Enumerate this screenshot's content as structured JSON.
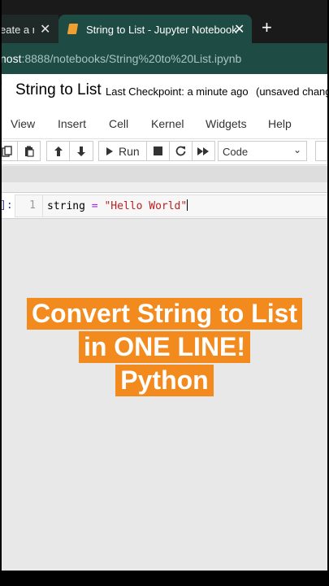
{
  "browser": {
    "inactive_tab_title": "eate a n",
    "active_tab_title": "String to List - Jupyter Notebook",
    "close_glyph": "✕",
    "new_tab_glyph": "+",
    "url_host": "nost",
    "url_rest": ":8888/notebooks/String%20to%20List.ipynb"
  },
  "notebook": {
    "title": "String to List",
    "checkpoint": "Last Checkpoint: a minute ago",
    "unsaved": "(unsaved chang"
  },
  "menu": [
    "View",
    "Insert",
    "Cell",
    "Kernel",
    "Widgets",
    "Help"
  ],
  "toolbar": {
    "run_label": "Run",
    "cell_type": "Code"
  },
  "cell": {
    "prompt": "]:",
    "line_number": "1",
    "code_var": "string",
    "code_op": "=",
    "code_string": "\"Hello World\""
  },
  "caption": {
    "line1": "Convert String to List",
    "line2": "in ONE LINE!",
    "line3": "Python"
  },
  "colors": {
    "caption_bg": "#f28a1e",
    "tab_active": "#1f4b45",
    "string_literal": "#ba2121"
  }
}
